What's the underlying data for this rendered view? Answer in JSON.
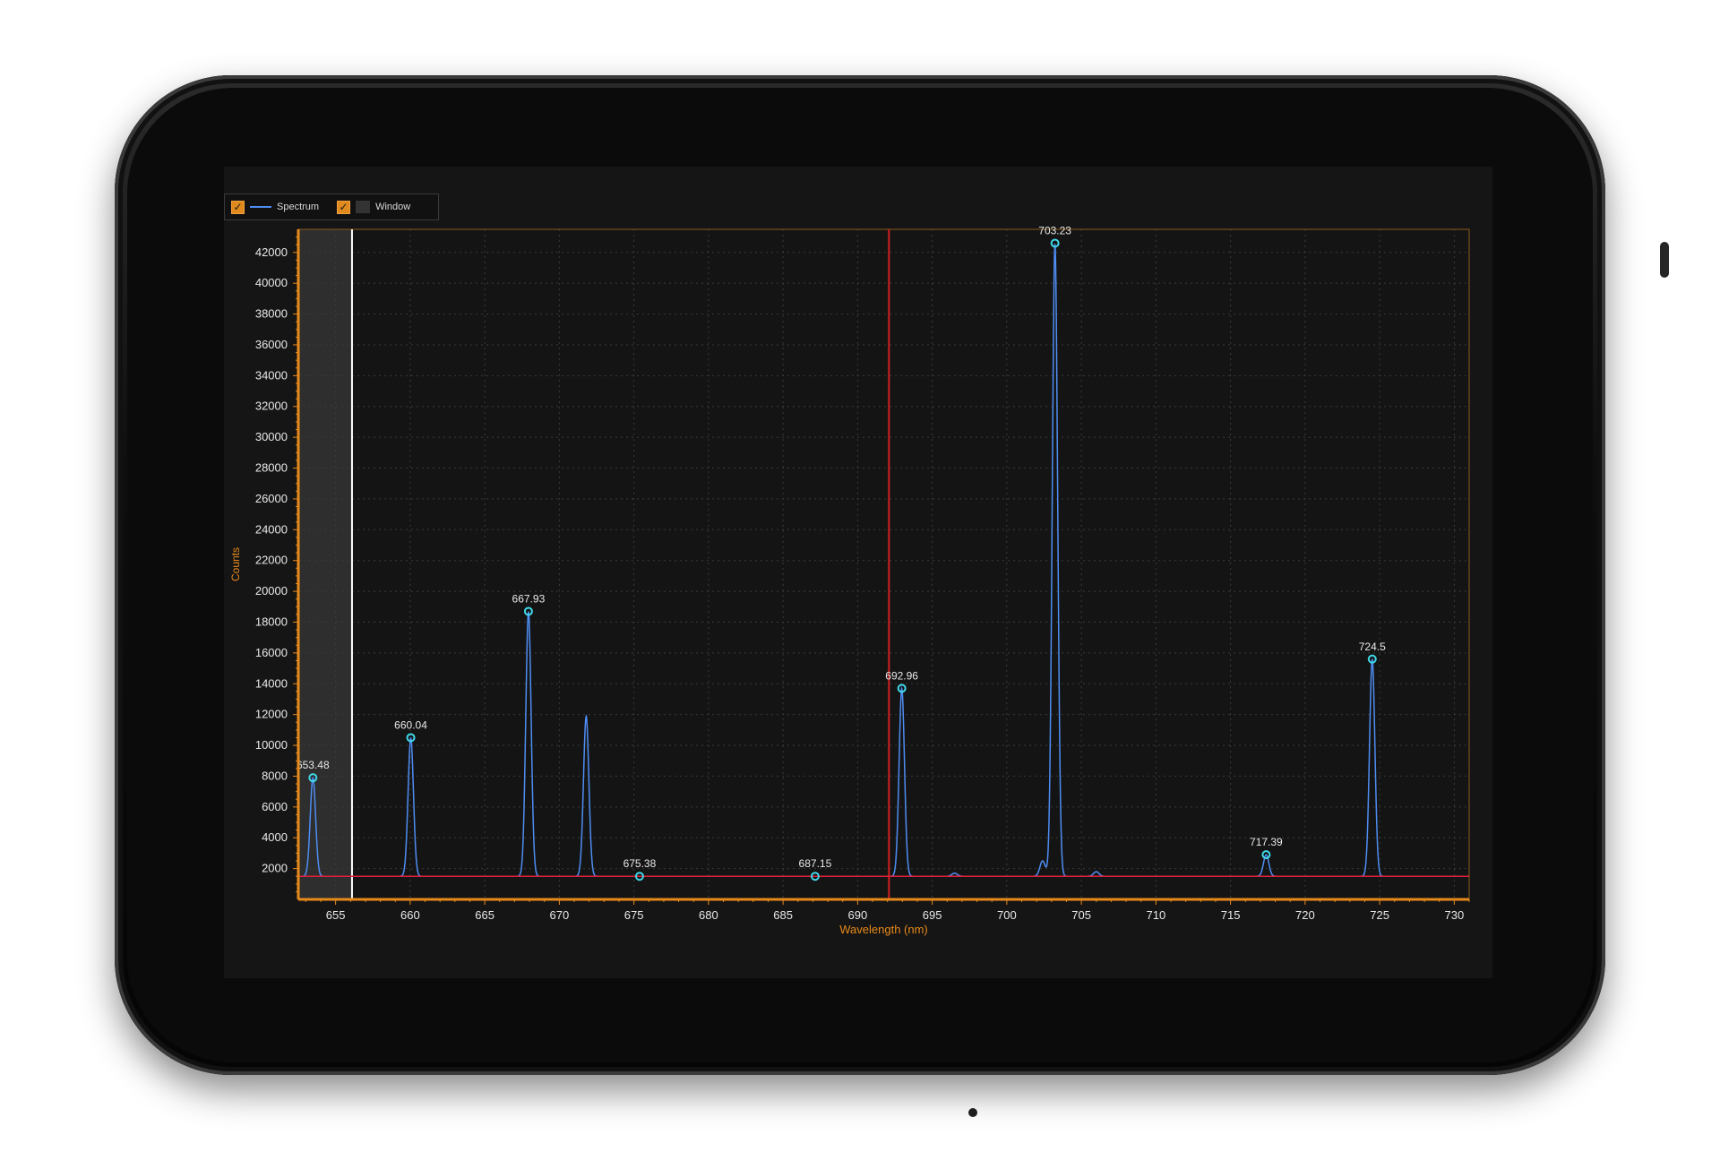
{
  "legend": {
    "items": [
      {
        "label": "Spectrum",
        "checked": true,
        "color": "#4f8df2"
      },
      {
        "label": "Window",
        "checked": true,
        "color": "#333333"
      }
    ]
  },
  "chart_data": {
    "type": "line",
    "xlabel": "Wavelength (nm)",
    "ylabel": "Counts",
    "xlim": [
      652.5,
      731
    ],
    "ylim": [
      0,
      43500
    ],
    "x_ticks": [
      655,
      660,
      665,
      670,
      675,
      680,
      685,
      690,
      695,
      700,
      705,
      710,
      715,
      720,
      725,
      730
    ],
    "y_ticks": [
      2000,
      4000,
      6000,
      8000,
      10000,
      12000,
      14000,
      16000,
      18000,
      20000,
      22000,
      24000,
      26000,
      28000,
      30000,
      32000,
      34000,
      36000,
      38000,
      40000,
      42000
    ],
    "grid": true,
    "baseline": 1500,
    "window_region": [
      652.5,
      656.1
    ],
    "cursor_x": 692.1,
    "series": [
      {
        "name": "Spectrum",
        "color": "#4f8df2",
        "peaks": [
          {
            "x": 653.48,
            "y": 7900
          },
          {
            "x": 660.04,
            "y": 10500
          },
          {
            "x": 667.93,
            "y": 18700
          },
          {
            "x": 671.8,
            "y": 11900
          },
          {
            "x": 675.38,
            "y": 1500
          },
          {
            "x": 687.15,
            "y": 1500
          },
          {
            "x": 692.96,
            "y": 13700
          },
          {
            "x": 696.5,
            "y": 1700
          },
          {
            "x": 702.4,
            "y": 2500
          },
          {
            "x": 703.23,
            "y": 42600
          },
          {
            "x": 706.0,
            "y": 1800
          },
          {
            "x": 717.39,
            "y": 2900
          },
          {
            "x": 724.5,
            "y": 15600
          }
        ]
      }
    ],
    "annotations": [
      {
        "label": "653.48",
        "x": 653.48,
        "y": 7900
      },
      {
        "label": "660.04",
        "x": 660.04,
        "y": 10500
      },
      {
        "label": "667.93",
        "x": 667.93,
        "y": 18700
      },
      {
        "label": "675.38",
        "x": 675.38,
        "y": 1500
      },
      {
        "label": "687.15",
        "x": 687.15,
        "y": 1500
      },
      {
        "label": "692.96",
        "x": 692.96,
        "y": 13700
      },
      {
        "label": "703.23",
        "x": 703.23,
        "y": 42600
      },
      {
        "label": "717.39",
        "x": 717.39,
        "y": 2900
      },
      {
        "label": "724.5",
        "x": 724.5,
        "y": 15600
      }
    ],
    "colors": {
      "axis": "#e88a1a",
      "grid": "#3a3a3a",
      "cursor": "#d02020",
      "baseline": "#e0203a",
      "marker": "#40d8e8",
      "window_edge": "#ffffff",
      "window_fill": "#2e2e2e",
      "text": "#e8e8e8"
    }
  }
}
